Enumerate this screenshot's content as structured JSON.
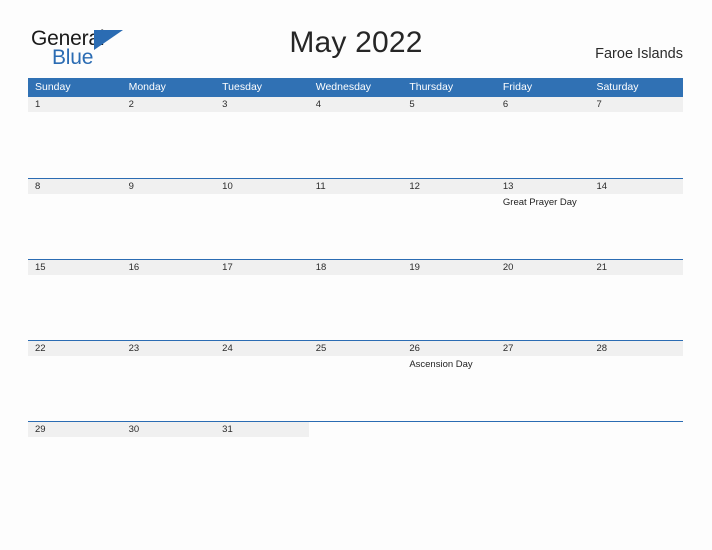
{
  "brand": {
    "word_one": "General",
    "word_two": "Blue",
    "flag_icon": "flag-triangle-icon",
    "accent_color": "#2b6cb3"
  },
  "header": {
    "title": "May 2022",
    "region": "Faroe Islands"
  },
  "theme": {
    "header_blue": "#3071b4",
    "band_gray": "#f0f0f0",
    "rule_blue": "#2b6cb3",
    "page_background": "#fdfdfd"
  },
  "calendar": {
    "weekdays": [
      "Sunday",
      "Monday",
      "Tuesday",
      "Wednesday",
      "Thursday",
      "Friday",
      "Saturday"
    ],
    "weeks": [
      {
        "days": [
          {
            "date": "1",
            "event": ""
          },
          {
            "date": "2",
            "event": ""
          },
          {
            "date": "3",
            "event": ""
          },
          {
            "date": "4",
            "event": ""
          },
          {
            "date": "5",
            "event": ""
          },
          {
            "date": "6",
            "event": ""
          },
          {
            "date": "7",
            "event": ""
          }
        ]
      },
      {
        "days": [
          {
            "date": "8",
            "event": ""
          },
          {
            "date": "9",
            "event": ""
          },
          {
            "date": "10",
            "event": ""
          },
          {
            "date": "11",
            "event": ""
          },
          {
            "date": "12",
            "event": ""
          },
          {
            "date": "13",
            "event": "Great Prayer Day"
          },
          {
            "date": "14",
            "event": ""
          }
        ]
      },
      {
        "days": [
          {
            "date": "15",
            "event": ""
          },
          {
            "date": "16",
            "event": ""
          },
          {
            "date": "17",
            "event": ""
          },
          {
            "date": "18",
            "event": ""
          },
          {
            "date": "19",
            "event": ""
          },
          {
            "date": "20",
            "event": ""
          },
          {
            "date": "21",
            "event": ""
          }
        ]
      },
      {
        "days": [
          {
            "date": "22",
            "event": ""
          },
          {
            "date": "23",
            "event": ""
          },
          {
            "date": "24",
            "event": ""
          },
          {
            "date": "25",
            "event": ""
          },
          {
            "date": "26",
            "event": "Ascension Day"
          },
          {
            "date": "27",
            "event": ""
          },
          {
            "date": "28",
            "event": ""
          }
        ]
      },
      {
        "days": [
          {
            "date": "29",
            "event": ""
          },
          {
            "date": "30",
            "event": ""
          },
          {
            "date": "31",
            "event": ""
          },
          {
            "date": "",
            "event": ""
          },
          {
            "date": "",
            "event": ""
          },
          {
            "date": "",
            "event": ""
          },
          {
            "date": "",
            "event": ""
          }
        ]
      }
    ]
  }
}
